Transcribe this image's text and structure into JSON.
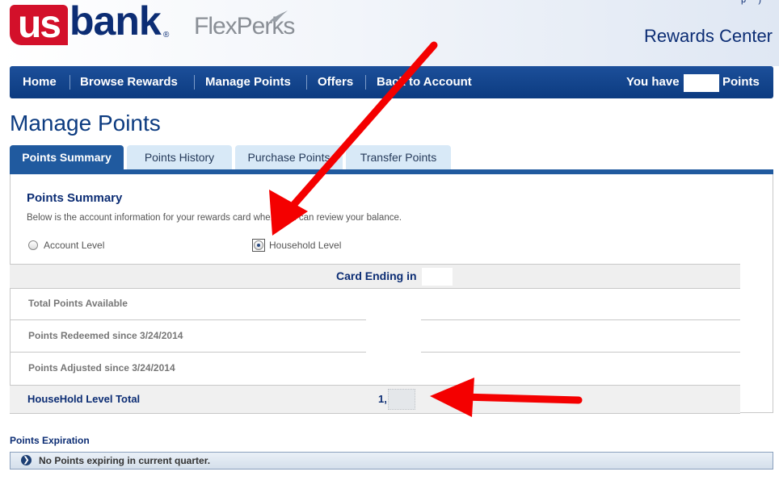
{
  "header": {
    "logo_us": "us",
    "logo_bank": "bank",
    "logo_reg": "®",
    "flexperks": "FlexPerks",
    "rewards_center": "Rewards Center"
  },
  "nav": {
    "items": [
      "Home",
      "Browse Rewards",
      "Manage Points",
      "Offers",
      "Back to Account"
    ],
    "you_have": "You have",
    "points": "Points"
  },
  "page_title": "Manage Points",
  "tabs": [
    "Points Summary",
    "Points History",
    "Purchase Points",
    "Transfer Points"
  ],
  "summary": {
    "title": "Points Summary",
    "description": "Below is the account information for your rewards card where you can review your balance.",
    "radios": [
      {
        "label": "Account Level",
        "selected": false
      },
      {
        "label": "Household Level",
        "selected": true
      }
    ],
    "card_ending": "Card Ending in",
    "rows": [
      "Total Points Available",
      "Points Redeemed since 3/24/2014",
      "Points Adjusted since 3/24/2014"
    ],
    "total_label": "HouseHold Level Total",
    "total_value": "1,"
  },
  "expiration": {
    "title": "Points Expiration",
    "message": "No Points expiring in current quarter."
  },
  "colors": {
    "brand_red": "#d3102a",
    "brand_navy": "#0c2d74",
    "nav_blue": "#1c4f9a",
    "arrow_red": "#f40000"
  }
}
